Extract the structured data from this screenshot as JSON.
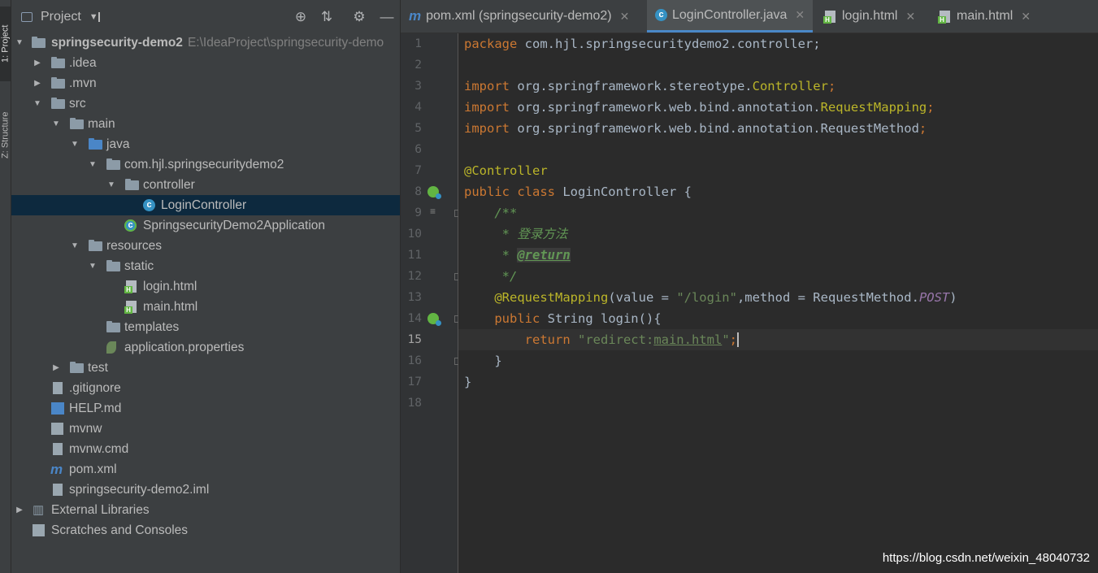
{
  "side_strip": {
    "project_tab": "1: Project",
    "structure_tab": "Z: Structure"
  },
  "project_panel": {
    "title": "Project",
    "tree": [
      {
        "label": "springsecurity-demo2",
        "path": "E:\\IdeaProject\\springsecurity-demo",
        "icon": "module-folder-icon"
      },
      {
        "label": ".idea"
      },
      {
        "label": ".mvn"
      },
      {
        "label": "src"
      },
      {
        "label": "main"
      },
      {
        "label": "java"
      },
      {
        "label": "com.hjl.springsecuritydemo2"
      },
      {
        "label": "controller"
      },
      {
        "label": "LoginController"
      },
      {
        "label": "SpringsecurityDemo2Application"
      },
      {
        "label": "resources"
      },
      {
        "label": "static"
      },
      {
        "label": "login.html"
      },
      {
        "label": "main.html"
      },
      {
        "label": "templates"
      },
      {
        "label": "application.properties"
      },
      {
        "label": "test"
      },
      {
        "label": ".gitignore"
      },
      {
        "label": "HELP.md"
      },
      {
        "label": "mvnw"
      },
      {
        "label": "mvnw.cmd"
      },
      {
        "label": "pom.xml"
      },
      {
        "label": "springsecurity-demo2.iml"
      },
      {
        "label": "External Libraries"
      },
      {
        "label": "Scratches and Consoles"
      }
    ]
  },
  "editor_tabs": [
    {
      "label": "pom.xml (springsecurity-demo2)",
      "icon": "maven-icon"
    },
    {
      "label": "LoginController.java",
      "icon": "java-class-icon",
      "active": true
    },
    {
      "label": "login.html",
      "icon": "html-file-icon"
    },
    {
      "label": "main.html",
      "icon": "html-file-icon"
    }
  ],
  "code": {
    "current_line": 15,
    "line_numbers": [
      "1",
      "2",
      "3",
      "4",
      "5",
      "6",
      "7",
      "8",
      "9",
      "10",
      "11",
      "12",
      "13",
      "14",
      "15",
      "16",
      "17",
      "18"
    ],
    "l1_kw": "package",
    "l1_rest": " com.hjl.springsecuritydemo2.controller;",
    "l3_kw": "import",
    "l3_pkg": " org.springframework.stereotype.",
    "l3_cls": "Controller",
    "l3_end": ";",
    "l4_kw": "import",
    "l4_pkg": " org.springframework.web.bind.annotation.",
    "l4_cls": "RequestMapping",
    "l4_end": ";",
    "l5_kw": "import",
    "l5_pkg": " org.springframework.web.bind.annotation.RequestMethod",
    "l5_end": ";",
    "l7_ann": "@Controller",
    "l8_kw": "public class",
    "l8_rest": " LoginController {",
    "l9_cmt": "    /**",
    "l10_cmt": "     * 登录方法",
    "l11_cmt": "     * ",
    "l11_tag": "@return",
    "l12_cmt": "     */",
    "l13_ann": "    @RequestMapping",
    "l13_a": "(value = ",
    "l13_str": "\"/login\"",
    "l13_b": ",method = RequestMethod.",
    "l13_post": "POST",
    "l13_c": ")",
    "l14_kw": "    public",
    "l14_rest": " String login(){",
    "l15_kw": "        return",
    "l15_str1": " \"redirect:",
    "l15_link": "main.html",
    "l15_str2": "\"",
    "l15_end": ";",
    "l16": "    }",
    "l17": "}"
  },
  "watermark": "https://blog.csdn.net/weixin_48040732",
  "colors": {
    "editor_bg": "#2b2b2b",
    "panel_bg": "#3c3f41",
    "keyword": "#cc7832",
    "string": "#6a8759",
    "annotation": "#bbb529",
    "comment": "#629755",
    "selection": "#0d293e"
  }
}
